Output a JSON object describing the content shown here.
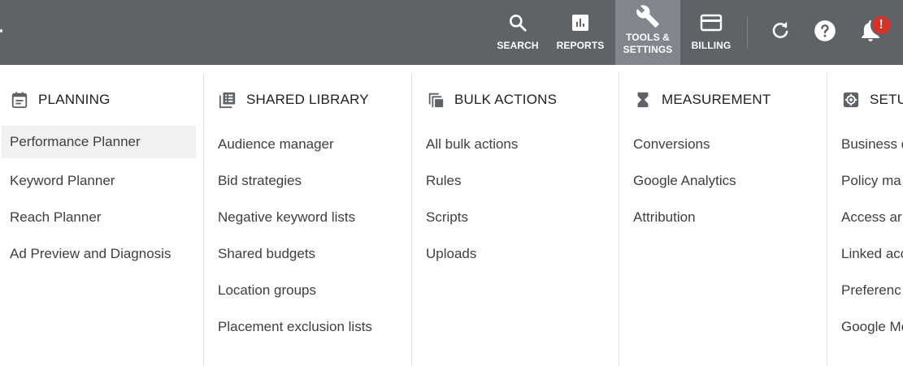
{
  "topbar": {
    "search_label": "SEARCH",
    "reports_label": "REPORTS",
    "tools_label_line1": "TOOLS &",
    "tools_label_line2": "SETTINGS",
    "billing_label": "BILLING",
    "notification_badge": "!",
    "icons": {
      "search": "search-icon",
      "reports": "reports-icon",
      "tools": "wrench-icon",
      "billing": "credit-card-icon",
      "refresh": "refresh-icon",
      "help": "help-icon",
      "notifications": "bell-icon"
    }
  },
  "menu": {
    "planning": {
      "title": "PLANNING",
      "icon": "calendar-icon",
      "items": [
        "Performance Planner",
        "Keyword Planner",
        "Reach Planner",
        "Ad Preview and Diagnosis"
      ]
    },
    "shared_library": {
      "title": "SHARED LIBRARY",
      "icon": "library-icon",
      "items": [
        "Audience manager",
        "Bid strategies",
        "Negative keyword lists",
        "Shared budgets",
        "Location groups",
        "Placement exclusion lists"
      ]
    },
    "bulk_actions": {
      "title": "BULK ACTIONS",
      "icon": "copy-icon",
      "items": [
        "All bulk actions",
        "Rules",
        "Scripts",
        "Uploads"
      ]
    },
    "measurement": {
      "title": "MEASUREMENT",
      "icon": "hourglass-icon",
      "items": [
        "Conversions",
        "Google Analytics",
        "Attribution"
      ]
    },
    "setup": {
      "title": "SETU",
      "icon": "gear-icon",
      "items": [
        "Business d",
        "Policy ma",
        "Access ar",
        "Linked acc",
        "Preferenc",
        "Google Mo"
      ]
    }
  },
  "colors": {
    "topbar_bg": "#5f6368",
    "tools_active_bg": "#80868b",
    "badge_red": "#d93025",
    "active_item_bg": "#f1f1f1",
    "text": "#3c4043",
    "icon_gray": "#5f6368"
  }
}
